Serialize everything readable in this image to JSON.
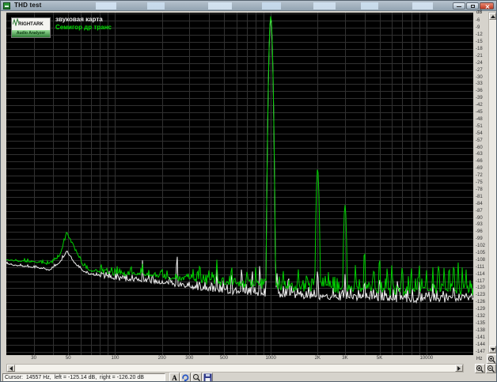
{
  "window": {
    "title": "THD test"
  },
  "logo": {
    "top_left": "RIGHT",
    "top_right": "ARK",
    "bottom": "Audio Analyzer"
  },
  "legend": {
    "series": [
      {
        "name": "звуковая карта",
        "color": "#f2f2f2"
      },
      {
        "name": "Семигор др транс",
        "color": "#00dd00"
      }
    ]
  },
  "axes": {
    "y_unit": "dB",
    "x_unit": "Hz",
    "y_ticks": [
      -6,
      -9,
      -12,
      -15,
      -18,
      -21,
      -24,
      -27,
      -30,
      -33,
      -36,
      -39,
      -42,
      -45,
      -48,
      -51,
      -54,
      -57,
      -60,
      -63,
      -66,
      -69,
      -72,
      -75,
      -78,
      -81,
      -84,
      -87,
      -90,
      -93,
      -96,
      -99,
      -102,
      -105,
      -108,
      -111,
      -114,
      -117,
      -120,
      -123,
      -126,
      -129,
      -132,
      -135,
      -138,
      -141,
      -144,
      -147
    ],
    "x_ticks": [
      [
        30,
        "30"
      ],
      [
        50,
        "50"
      ],
      [
        100,
        "100"
      ],
      [
        200,
        "200"
      ],
      [
        300,
        "300"
      ],
      [
        500,
        "500"
      ],
      [
        1000,
        "1000"
      ],
      [
        2000,
        "2K"
      ],
      [
        3000,
        "3K"
      ],
      [
        5000,
        "5K"
      ],
      [
        10000,
        "10000"
      ]
    ]
  },
  "statusbar": {
    "cursor_text": "Cursor:  14557 Hz,  left = -125.14 dB,  right = -126.20 dB",
    "font_button_label": "A"
  },
  "chart_data": {
    "type": "line",
    "title": "THD test spectrum",
    "x_scale": "log",
    "xlabel": "Hz",
    "ylabel": "dB",
    "x_range_hz": [
      20,
      20000
    ],
    "y_range_db": [
      -148.5,
      -2.5
    ],
    "grid_step_db": 3,
    "grid_color": "#313131",
    "background": "#000000",
    "series": [
      {
        "name": "звуковая карта",
        "color": "#eeeeee",
        "seed": 7,
        "baseline": [
          [
            20,
            -109.5
          ],
          [
            30,
            -111
          ],
          [
            38,
            -112
          ],
          [
            44,
            -109
          ],
          [
            49,
            -104.3
          ],
          [
            55,
            -109
          ],
          [
            62,
            -112.5
          ],
          [
            70,
            -114
          ],
          [
            90,
            -115
          ],
          [
            120,
            -116
          ],
          [
            160,
            -116.5
          ],
          [
            200,
            -117.5
          ],
          [
            260,
            -118.5
          ],
          [
            350,
            -119.5
          ],
          [
            500,
            -120.5
          ],
          [
            700,
            -121.5
          ],
          [
            1000,
            -122
          ],
          [
            1500,
            -122.5
          ],
          [
            2500,
            -123
          ],
          [
            4000,
            -123.5
          ],
          [
            7000,
            -124
          ],
          [
            12000,
            -124
          ],
          [
            20000,
            -123.5
          ]
        ],
        "peaks": [
          [
            150,
            -108,
            8
          ],
          [
            250,
            -106,
            8
          ],
          [
            450,
            -112,
            9
          ],
          [
            560,
            -113,
            9
          ],
          [
            650,
            -111,
            9
          ],
          [
            760,
            -112,
            9
          ],
          [
            850,
            -110,
            9
          ],
          [
            950,
            -112,
            9
          ],
          [
            1000,
            -5,
            3
          ],
          [
            1100,
            -113,
            9
          ],
          [
            1300,
            -114,
            9
          ],
          [
            2000,
            -112,
            8
          ],
          [
            3000,
            -114,
            8
          ],
          [
            4000,
            -116,
            9
          ],
          [
            5000,
            -115,
            9
          ],
          [
            6500,
            -117,
            9
          ],
          [
            9000,
            -117,
            9
          ],
          [
            11000,
            -118,
            9
          ],
          [
            15000,
            -118,
            9
          ]
        ],
        "noise_amp": [
          [
            80,
            0.5
          ],
          [
            300,
            1.3
          ],
          [
            1000,
            2.0
          ],
          [
            5000,
            2.3
          ],
          [
            21000,
            2.4
          ]
        ]
      },
      {
        "name": "Семигор др транс",
        "color": "#00cf00",
        "seed": 13,
        "baseline": [
          [
            20,
            -107.8
          ],
          [
            30,
            -108.5
          ],
          [
            38,
            -109.5
          ],
          [
            44,
            -106
          ],
          [
            49,
            -96.3
          ],
          [
            55,
            -103
          ],
          [
            62,
            -110
          ],
          [
            70,
            -112.5
          ],
          [
            90,
            -113
          ],
          [
            120,
            -113.5
          ],
          [
            160,
            -114
          ],
          [
            200,
            -114.5
          ],
          [
            260,
            -115.5
          ],
          [
            350,
            -116
          ],
          [
            500,
            -117
          ],
          [
            700,
            -118
          ],
          [
            1000,
            -118.5
          ],
          [
            1500,
            -119
          ],
          [
            2500,
            -119.5
          ],
          [
            4000,
            -120
          ],
          [
            7000,
            -120
          ],
          [
            12000,
            -119.5
          ],
          [
            20000,
            -120
          ]
        ],
        "peaks": [
          [
            100,
            -110,
            8
          ],
          [
            150,
            -109.5,
            8
          ],
          [
            200,
            -111,
            8
          ],
          [
            350,
            -109,
            8
          ],
          [
            450,
            -107.8,
            8
          ],
          [
            560,
            -110,
            8
          ],
          [
            700,
            -112,
            9
          ],
          [
            800,
            -111,
            9
          ],
          [
            1000,
            -4,
            3
          ],
          [
            1200,
            -112,
            8
          ],
          [
            1500,
            -111.5,
            8
          ],
          [
            1700,
            -113,
            8
          ],
          [
            2000,
            -69,
            4
          ],
          [
            2350,
            -113,
            8
          ],
          [
            3000,
            -84.5,
            4
          ],
          [
            3500,
            -110,
            8
          ],
          [
            4000,
            -104,
            7
          ],
          [
            4600,
            -111,
            8
          ],
          [
            5000,
            -107,
            7
          ],
          [
            5600,
            -111,
            8
          ],
          [
            6000,
            -110,
            8
          ],
          [
            7000,
            -110.5,
            8
          ],
          [
            8000,
            -111,
            8
          ],
          [
            9000,
            -110,
            8
          ],
          [
            10000,
            -112,
            8
          ],
          [
            11000,
            -111,
            8
          ],
          [
            12000,
            -109.5,
            8
          ],
          [
            13000,
            -111,
            8
          ],
          [
            14000,
            -110.5,
            8
          ],
          [
            15000,
            -109.5,
            8
          ],
          [
            16000,
            -109,
            8
          ],
          [
            17000,
            -111,
            8
          ],
          [
            18000,
            -112,
            8
          ]
        ],
        "noise_amp": [
          [
            80,
            0.7
          ],
          [
            300,
            1.6
          ],
          [
            1000,
            2.4
          ],
          [
            5000,
            3.0
          ],
          [
            21000,
            3.8
          ]
        ]
      }
    ],
    "key_values": {
      "fundamental_hz": 1000,
      "fundamental_db": -4,
      "harmonic_2_hz": 2000,
      "harmonic_2_db": -69,
      "harmonic_3_hz": 3000,
      "harmonic_3_db": -84.5,
      "hum_50hz_db_series2": -96,
      "hum_50hz_db_series1": -104
    }
  }
}
